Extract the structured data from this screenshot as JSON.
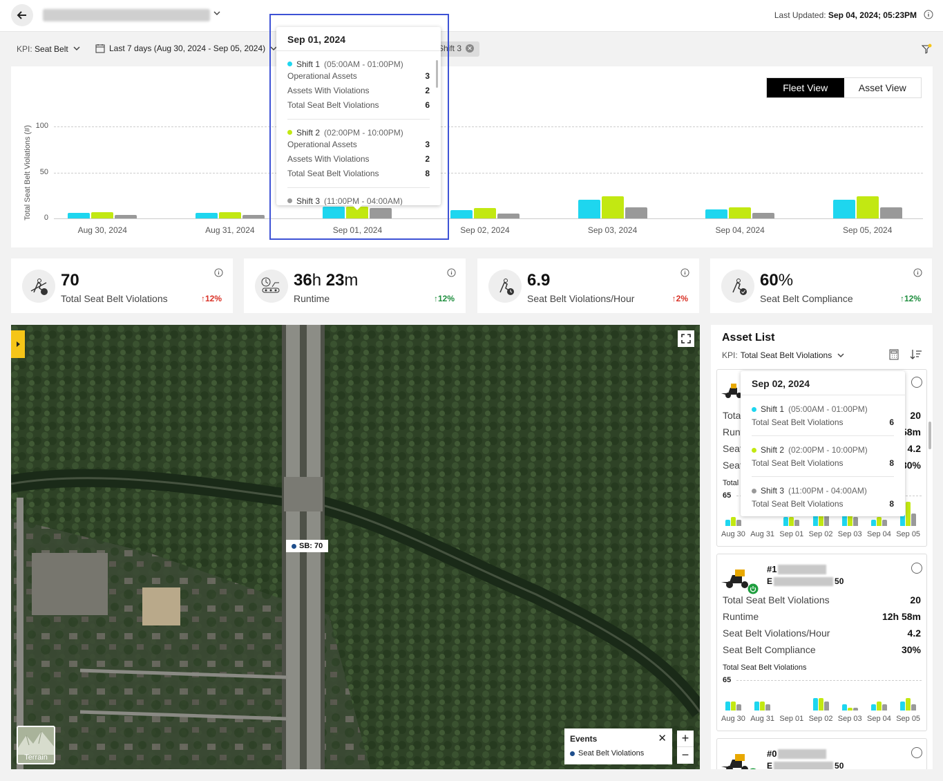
{
  "header": {
    "last_updated_label": "Last Updated:",
    "last_updated_value": "Sep 04, 2024; 05:23PM"
  },
  "filters": {
    "kpi_prefix": "KPI:",
    "kpi_value": "Seat Belt",
    "date_range": "Last 7 days (Aug 30, 2024 - Sep 05, 2024)",
    "shift_chip": "Shift 3"
  },
  "view_toggle": {
    "fleet": "Fleet View",
    "asset": "Asset View",
    "active": "fleet"
  },
  "colors": {
    "shift1": "#1ed6ef",
    "shift2": "#c2e812",
    "shift3": "#999999",
    "highlight": "#3d52d5",
    "up_bad": "#d93025",
    "up_good": "#1e8e3e",
    "map_tab": "#f5c518"
  },
  "chart_data": {
    "type": "bar",
    "ylabel": "Total Seat Belt Violations (#)",
    "ylim": [
      0,
      100
    ],
    "yticks": [
      0,
      50,
      100
    ],
    "grid": true,
    "categories": [
      "Aug 30, 2024",
      "Aug 31, 2024",
      "Sep 01, 2024",
      "Sep 02, 2024",
      "Sep 03, 2024",
      "Sep 04, 2024",
      "Sep 05, 2024"
    ],
    "series": [
      {
        "name": "Shift 1",
        "values": [
          6,
          6,
          13,
          9,
          20,
          10,
          20
        ]
      },
      {
        "name": "Shift 2",
        "values": [
          7,
          7,
          13,
          11,
          24,
          12,
          24
        ]
      },
      {
        "name": "Shift 3",
        "values": [
          4,
          4,
          11,
          5,
          12,
          6,
          12
        ]
      }
    ]
  },
  "main_tooltip": {
    "date": "Sep 01, 2024",
    "shifts": [
      {
        "name": "Shift 1",
        "time": "(05:00AM - 01:00PM)",
        "rows": [
          [
            "Operational Assets",
            "3"
          ],
          [
            "Assets With Violations",
            "2"
          ],
          [
            "Total Seat Belt Violations",
            "6"
          ]
        ]
      },
      {
        "name": "Shift 2",
        "time": "(02:00PM - 10:00PM)",
        "rows": [
          [
            "Operational Assets",
            "3"
          ],
          [
            "Assets With Violations",
            "2"
          ],
          [
            "Total Seat Belt Violations",
            "8"
          ]
        ]
      },
      {
        "name": "Shift 3",
        "time": "(11:00PM - 04:00AM)",
        "rows": []
      }
    ]
  },
  "kpis": [
    {
      "value": "70",
      "label": "Total Seat Belt Violations",
      "trend": "12%",
      "icon": "seatbelt-violation-icon"
    },
    {
      "value_h": "36",
      "value_m": "23",
      "label": "Runtime",
      "trend": "12%",
      "icon": "machine-runtime-icon"
    },
    {
      "value": "6.9",
      "label": "Seat Belt Violations/Hour",
      "trend": "2%",
      "icon": "violations-hour-icon"
    },
    {
      "value": "60",
      "unit": "%",
      "label": "Seat Belt Compliance",
      "trend": "12%",
      "icon": "compliance-icon"
    }
  ],
  "map": {
    "marker_label": "SB: 70",
    "terrain_label": "Terrain",
    "events_title": "Events",
    "events_item": "Seat Belt Violations",
    "zoom_in": "+",
    "zoom_out": "−"
  },
  "asset_list": {
    "title": "Asset List",
    "kpi_prefix": "KPI:",
    "kpi_value": "Total Seat Belt Violations",
    "mini_days": [
      "Aug 30",
      "Aug 31",
      "Sep 01",
      "Sep 02",
      "Sep 03",
      "Sep 04",
      "Sep 05"
    ],
    "mini_chart_title": "Total Seat Belt Violations",
    "mini_max": "65",
    "card1": {
      "rows": [
        [
          "Total",
          "20"
        ],
        [
          "Runt",
          "58m"
        ],
        [
          "Seat",
          "4.2"
        ],
        [
          "Seat",
          "30%"
        ]
      ],
      "mini": {
        "s1": [
          2,
          0,
          3,
          5,
          5,
          2,
          6
        ],
        "s2": [
          3,
          0,
          3,
          4,
          5,
          3,
          8
        ],
        "s3": [
          2,
          0,
          2,
          5,
          3,
          2,
          4
        ]
      }
    },
    "card2": {
      "id_prefix": "#1",
      "sub_prefix": "E",
      "sub_suffix": "50",
      "rows": [
        [
          "Total Seat Belt Violations",
          "20"
        ],
        [
          "Runtime",
          "12h 58m"
        ],
        [
          "Seat Belt Violations/Hour",
          "4.2"
        ],
        [
          "Seat Belt Compliance",
          "30%"
        ]
      ],
      "mini": {
        "s1": [
          3,
          3,
          0,
          4,
          2,
          2,
          3
        ],
        "s2": [
          3,
          3,
          0,
          4,
          1,
          3,
          4
        ],
        "s3": [
          2,
          2,
          0,
          3,
          1,
          2,
          2
        ]
      }
    },
    "card3": {
      "id_prefix": "#0",
      "sub_prefix": "E",
      "sub_suffix": "50"
    }
  },
  "asset_tooltip": {
    "date": "Sep 02, 2024",
    "shifts": [
      {
        "name": "Shift 1",
        "time": "(05:00AM - 01:00PM)",
        "row": [
          "Total Seat Belt Violations",
          "6"
        ]
      },
      {
        "name": "Shift 2",
        "time": "(02:00PM - 10:00PM)",
        "row": [
          "Total Seat Belt Violations",
          "8"
        ]
      },
      {
        "name": "Shift 3",
        "time": "(11:00PM - 04:00AM)",
        "row": [
          "Total Seat Belt Violations",
          "8"
        ]
      }
    ]
  }
}
